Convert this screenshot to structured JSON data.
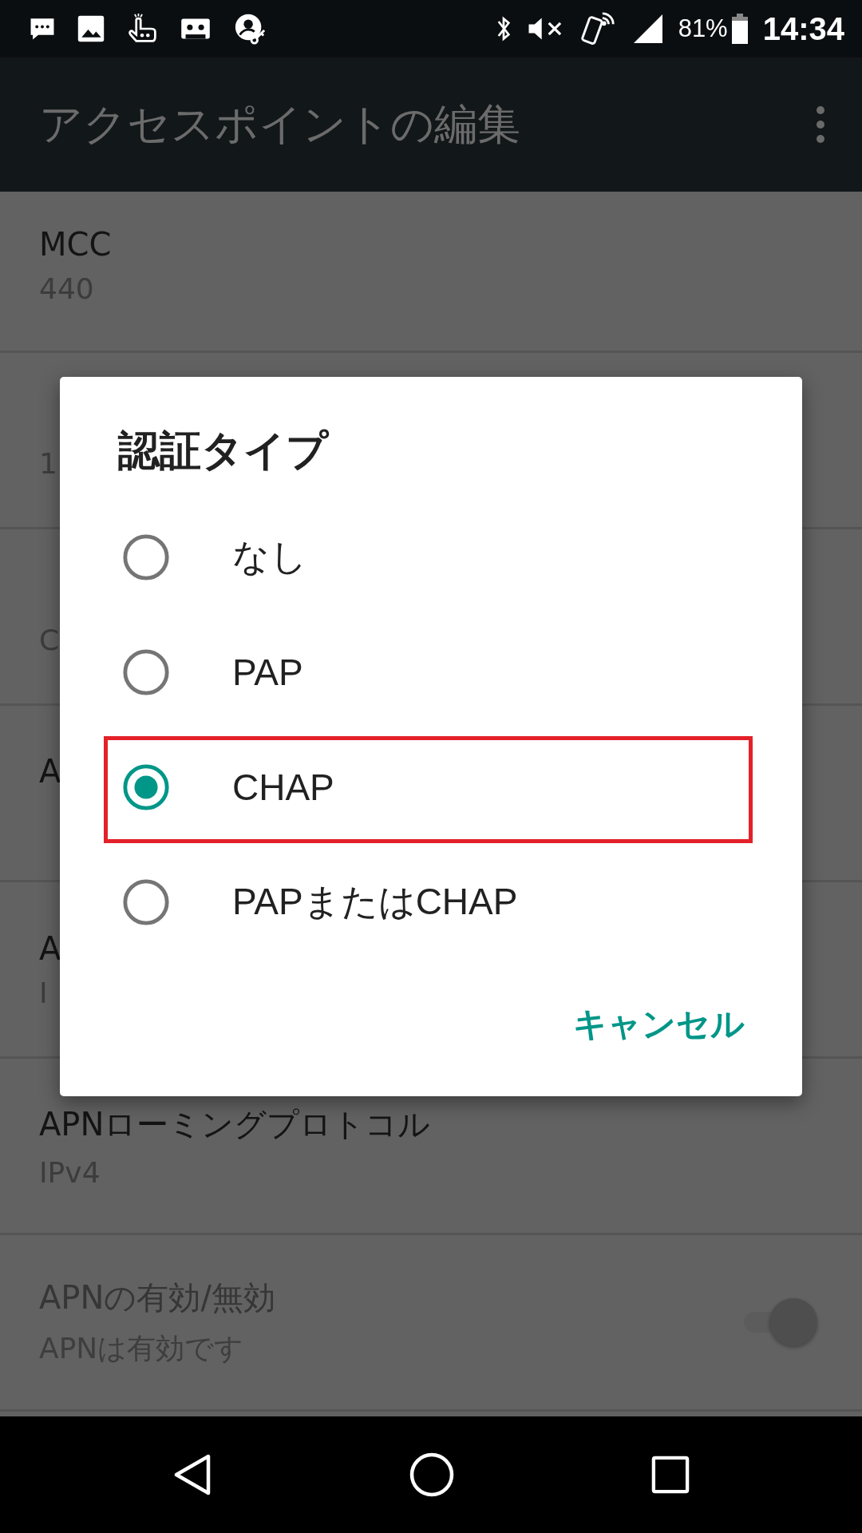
{
  "status_bar": {
    "battery_text": "81%",
    "time": "14:34"
  },
  "toolbar": {
    "title": "アクセスポイントの編集"
  },
  "rows": [
    {
      "kind": "text",
      "title": "MCC",
      "value": "440"
    },
    {
      "kind": "text",
      "value": "1"
    },
    {
      "kind": "text",
      "value": "C"
    },
    {
      "kind": "text",
      "title": "A"
    },
    {
      "kind": "text",
      "title": "A",
      "value": "I"
    },
    {
      "kind": "text",
      "title": "APNローミングプロトコル",
      "value": "IPv4"
    },
    {
      "kind": "toggle",
      "title": "APNの有効/無効",
      "value": "APNは有効です",
      "on": true,
      "disabled": true
    }
  ],
  "dialog": {
    "title": "認証タイプ",
    "options": [
      {
        "label": "なし",
        "selected": false,
        "highlighted": false
      },
      {
        "label": "PAP",
        "selected": false,
        "highlighted": false
      },
      {
        "label": "CHAP",
        "selected": true,
        "highlighted": true
      },
      {
        "label": "PAPまたはCHAP",
        "selected": false,
        "highlighted": false
      }
    ],
    "cancel": "キャンセル"
  }
}
